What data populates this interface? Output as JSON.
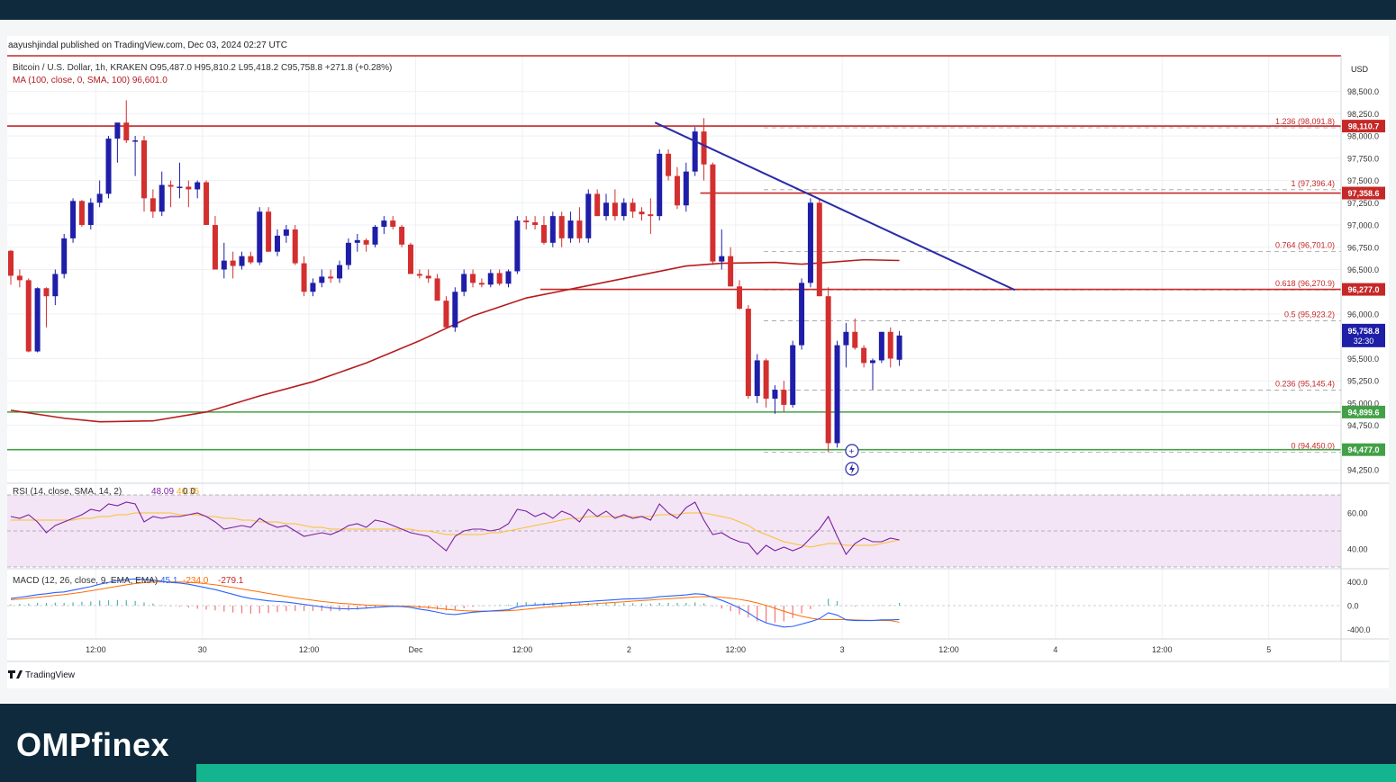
{
  "header": {
    "published": "aayushjindal published on TradingView.com, Dec 03, 2024 02:27 UTC"
  },
  "chart_data": {
    "type": "candlestick",
    "symbol_line": "Bitcoin / U.S. Dollar, 1h, KRAKEN  O95,487.0  H95,810.2  L95,418.2  C95,758.8  +271.8 (+0.28%)",
    "ma_line": "MA (100, close, 0, SMA, 100)  96,601.0",
    "currency": "USD",
    "price_axis": {
      "ylim": [
        94100,
        98900
      ],
      "ticks": [
        "98,500.0",
        "98,250.0",
        "98,000.0",
        "97,750.0",
        "97,500.0",
        "97,250.0",
        "97,000.0",
        "96,750.0",
        "96,500.0",
        "96,000.0",
        "95,500.0",
        "95,250.0",
        "95,000.0",
        "94,750.0",
        "94,250.0"
      ]
    },
    "time_axis": {
      "ticks": [
        {
          "label": "12:00",
          "bar": 12
        },
        {
          "label": "30",
          "bar": 24
        },
        {
          "label": "12:00",
          "bar": 36
        },
        {
          "label": "Dec",
          "bar": 48
        },
        {
          "label": "12:00",
          "bar": 60
        },
        {
          "label": "2",
          "bar": 72
        },
        {
          "label": "12:00",
          "bar": 84
        },
        {
          "label": "3",
          "bar": 96
        },
        {
          "label": "12:00",
          "bar": 108
        },
        {
          "label": "4",
          "bar": 120
        },
        {
          "label": "12:00",
          "bar": 132
        },
        {
          "label": "5",
          "bar": 144
        }
      ]
    },
    "candles": [
      [
        96710,
        96720,
        96330,
        96430
      ],
      [
        96430,
        96500,
        96300,
        96380
      ],
      [
        96380,
        96400,
        95570,
        95580
      ],
      [
        95580,
        96300,
        95570,
        96290
      ],
      [
        96290,
        96300,
        95850,
        96200
      ],
      [
        96200,
        96500,
        96100,
        96450
      ],
      [
        96450,
        96900,
        96400,
        96850
      ],
      [
        96850,
        97300,
        96800,
        97270
      ],
      [
        97270,
        97280,
        96980,
        97000
      ],
      [
        97000,
        97300,
        96950,
        97250
      ],
      [
        97250,
        97500,
        97200,
        97350
      ],
      [
        97350,
        98000,
        97300,
        97970
      ],
      [
        97970,
        98100,
        97700,
        98150
      ],
      [
        98150,
        98400,
        97920,
        97950
      ],
      [
        97950,
        98000,
        97550,
        97950
      ],
      [
        97950,
        98000,
        97150,
        97300
      ],
      [
        97300,
        97400,
        97080,
        97150
      ],
      [
        97150,
        97600,
        97100,
        97450
      ],
      [
        97450,
        97500,
        97200,
        97430
      ],
      [
        97430,
        97700,
        97300,
        97430
      ],
      [
        97430,
        97500,
        97200,
        97400
      ],
      [
        97400,
        97500,
        97300,
        97480
      ],
      [
        97480,
        97500,
        97000,
        97000
      ],
      [
        97000,
        97100,
        96500,
        96500
      ],
      [
        96500,
        96800,
        96400,
        96600
      ],
      [
        96600,
        96700,
        96400,
        96540
      ],
      [
        96540,
        96700,
        96500,
        96650
      ],
      [
        96650,
        96700,
        96560,
        96580
      ],
      [
        96580,
        97200,
        96550,
        97150
      ],
      [
        97150,
        97200,
        96700,
        96700
      ],
      [
        96700,
        96950,
        96650,
        96880
      ],
      [
        96880,
        97000,
        96800,
        96950
      ],
      [
        96950,
        97000,
        96550,
        96570
      ],
      [
        96570,
        96650,
        96200,
        96250
      ],
      [
        96250,
        96400,
        96200,
        96350
      ],
      [
        96350,
        96500,
        96300,
        96420
      ],
      [
        96420,
        96500,
        96350,
        96400
      ],
      [
        96400,
        96600,
        96350,
        96550
      ],
      [
        96550,
        96850,
        96500,
        96800
      ],
      [
        96800,
        96900,
        96700,
        96830
      ],
      [
        96830,
        96850,
        96700,
        96780
      ],
      [
        96780,
        97000,
        96750,
        96980
      ],
      [
        96980,
        97100,
        96900,
        97050
      ],
      [
        97050,
        97100,
        96950,
        96980
      ],
      [
        96980,
        97000,
        96750,
        96780
      ],
      [
        96780,
        96800,
        96450,
        96450
      ],
      [
        96450,
        96500,
        96400,
        96430
      ],
      [
        96430,
        96500,
        96350,
        96400
      ],
      [
        96400,
        96450,
        96150,
        96150
      ],
      [
        96150,
        96200,
        95850,
        95850
      ],
      [
        95850,
        96300,
        95800,
        96250
      ],
      [
        96250,
        96500,
        96200,
        96450
      ],
      [
        96450,
        96500,
        96300,
        96350
      ],
      [
        96350,
        96400,
        96300,
        96330
      ],
      [
        96330,
        96500,
        96300,
        96460
      ],
      [
        96460,
        96500,
        96320,
        96340
      ],
      [
        96340,
        96500,
        96300,
        96480
      ],
      [
        96480,
        97100,
        96450,
        97050
      ],
      [
        97050,
        97100,
        96950,
        97030
      ],
      [
        97030,
        97100,
        96950,
        97000
      ],
      [
        97000,
        97100,
        96780,
        96800
      ],
      [
        96800,
        97150,
        96750,
        97100
      ],
      [
        97100,
        97150,
        96750,
        96850
      ],
      [
        96850,
        97150,
        96800,
        97050
      ],
      [
        97050,
        97200,
        96800,
        96850
      ],
      [
        96850,
        97400,
        96800,
        97350
      ],
      [
        97350,
        97400,
        97100,
        97100
      ],
      [
        97100,
        97350,
        97050,
        97250
      ],
      [
        97250,
        97400,
        97050,
        97100
      ],
      [
        97100,
        97300,
        97050,
        97250
      ],
      [
        97250,
        97300,
        97080,
        97150
      ],
      [
        97150,
        97200,
        97050,
        97120
      ],
      [
        97120,
        97300,
        96900,
        97100
      ],
      [
        97100,
        97850,
        97050,
        97800
      ],
      [
        97800,
        97850,
        97500,
        97550
      ],
      [
        97550,
        97650,
        97180,
        97220
      ],
      [
        97220,
        97700,
        97150,
        97600
      ],
      [
        97600,
        98100,
        97550,
        98050
      ],
      [
        98050,
        98200,
        97500,
        97680
      ],
      [
        97680,
        97700,
        96550,
        96590
      ],
      [
        96590,
        96950,
        96500,
        96650
      ],
      [
        96650,
        96750,
        96310,
        96310
      ],
      [
        96310,
        96380,
        96050,
        96060
      ],
      [
        96060,
        96100,
        95050,
        95080
      ],
      [
        95080,
        95550,
        95000,
        95480
      ],
      [
        95480,
        95500,
        94950,
        95050
      ],
      [
        95050,
        95200,
        94880,
        95150
      ],
      [
        95150,
        95250,
        94900,
        94980
      ],
      [
        94980,
        95700,
        94950,
        95650
      ],
      [
        95650,
        96400,
        95600,
        96350
      ],
      [
        96350,
        97300,
        96300,
        97250
      ],
      [
        97250,
        97300,
        96200,
        96200
      ],
      [
        96200,
        96300,
        94450,
        94550
      ],
      [
        94550,
        95700,
        94500,
        95650
      ],
      [
        95650,
        95900,
        95400,
        95800
      ],
      [
        95800,
        95950,
        95600,
        95620
      ],
      [
        95620,
        95650,
        95400,
        95450
      ],
      [
        95450,
        95500,
        95150,
        95480
      ],
      [
        95480,
        95800,
        95450,
        95800
      ],
      [
        95800,
        95850,
        95400,
        95500
      ],
      [
        95487,
        95810,
        95418,
        95759
      ]
    ],
    "ma100": [
      {
        "bar": 0,
        "value": 94920
      },
      {
        "bar": 6,
        "value": 94830
      },
      {
        "bar": 10,
        "value": 94790
      },
      {
        "bar": 16,
        "value": 94800
      },
      {
        "bar": 22,
        "value": 94900
      },
      {
        "bar": 28,
        "value": 95080
      },
      {
        "bar": 34,
        "value": 95240
      },
      {
        "bar": 40,
        "value": 95450
      },
      {
        "bar": 46,
        "value": 95700
      },
      {
        "bar": 52,
        "value": 95980
      },
      {
        "bar": 58,
        "value": 96180
      },
      {
        "bar": 64,
        "value": 96300
      },
      {
        "bar": 70,
        "value": 96420
      },
      {
        "bar": 76,
        "value": 96540
      },
      {
        "bar": 80,
        "value": 96570
      },
      {
        "bar": 86,
        "value": 96580
      },
      {
        "bar": 89,
        "value": 96560
      },
      {
        "bar": 92,
        "value": 96580
      },
      {
        "bar": 96,
        "value": 96610
      },
      {
        "bar": 100,
        "value": 96601
      }
    ],
    "horizontal_lines": [
      {
        "price": 98900,
        "color": "#c62828",
        "from_bar": 0
      },
      {
        "price": 98110.7,
        "color": "#c62828",
        "from_bar": 0,
        "label": "98,110.7"
      },
      {
        "price": 97358.6,
        "color": "#c62828",
        "from_bar": 78,
        "label": "97,358.6"
      },
      {
        "price": 96277.0,
        "color": "#c62828",
        "from_bar": 60,
        "label": "96,277.0"
      },
      {
        "price": 94899.6,
        "color": "#43a047",
        "from_bar": 0,
        "label": "94,899.6"
      },
      {
        "price": 94477.0,
        "color": "#43a047",
        "from_bar": 0,
        "label": "94,477.0"
      }
    ],
    "trendline": {
      "from": {
        "bar": 72.5,
        "price": 98150
      },
      "to": {
        "bar": 113,
        "price": 96270
      },
      "color": "#2a2aa8"
    },
    "fibonacci": [
      {
        "label": "1.236 (98,091.8)",
        "price": 98091.8
      },
      {
        "label": "1 (97,396.4)",
        "price": 97396.4
      },
      {
        "label": "0.764 (96,701.0)",
        "price": 96701.0
      },
      {
        "label": "0.618 (96,270.9)",
        "price": 96270.9
      },
      {
        "label": "0.5 (95,923.2)",
        "price": 95923.2
      },
      {
        "label": "0.236 (95,145.4)",
        "price": 95145.4
      },
      {
        "label": "0 (94,450.0)",
        "price": 94450.0
      }
    ],
    "last_price": {
      "label": "95,758.8",
      "countdown": "32:30",
      "price": 95758.8
    },
    "rsi": {
      "header": "RSI (14, close, SMA, 14, 2)",
      "value": "48.09",
      "value2": "46.35",
      "extra": "0  0",
      "ticks": [
        "60.00",
        "40.00"
      ],
      "ylim": [
        30,
        75
      ],
      "band": [
        30,
        70
      ],
      "values": [
        58,
        57,
        59,
        55,
        49,
        53,
        55,
        57,
        59,
        62,
        61,
        65,
        64,
        66,
        65,
        55,
        58,
        57,
        58,
        58,
        59,
        60,
        58,
        55,
        51,
        52,
        53,
        52,
        57,
        54,
        52,
        53,
        50,
        47,
        48,
        49,
        48,
        50,
        53,
        54,
        52,
        56,
        55,
        53,
        51,
        49,
        48,
        47,
        43,
        39,
        47,
        50,
        51,
        51,
        50,
        51,
        54,
        62,
        61,
        58,
        60,
        57,
        61,
        59,
        55,
        62,
        58,
        61,
        57,
        59,
        57,
        58,
        56,
        65,
        60,
        57,
        63,
        66,
        56,
        48,
        49,
        46,
        44,
        43,
        37,
        42,
        39,
        41,
        39,
        41,
        46,
        51,
        58,
        47,
        37,
        43,
        46,
        44,
        44,
        46,
        45
      ],
      "sma": [
        56,
        56,
        56,
        56,
        56,
        56,
        56,
        56,
        57,
        57,
        58,
        58,
        59,
        59,
        60,
        60,
        60,
        60,
        60,
        59,
        59,
        59,
        58,
        58,
        57,
        57,
        56,
        56,
        55,
        55,
        55,
        54,
        54,
        53,
        52,
        52,
        51,
        51,
        51,
        51,
        51,
        51,
        51,
        51,
        51,
        51,
        50,
        50,
        49,
        48,
        48,
        48,
        48,
        48,
        49,
        49,
        50,
        51,
        52,
        53,
        54,
        55,
        56,
        57,
        57,
        58,
        58,
        58,
        58,
        58,
        58,
        58,
        58,
        59,
        59,
        59,
        60,
        60,
        60,
        59,
        58,
        57,
        55,
        53,
        50,
        48,
        46,
        44,
        43,
        42,
        41,
        42,
        43,
        43,
        42,
        42,
        42,
        42,
        43,
        44,
        45
      ]
    },
    "macd": {
      "header": "MACD (12, 26, close, 9, EMA, EMA)",
      "value": "45.1",
      "value2": "-234.0",
      "value3": "-279.1",
      "ticks": [
        "400.0",
        "0.0",
        "-400.0"
      ],
      "ylim": [
        -560,
        560
      ],
      "macd": [
        120,
        140,
        160,
        185,
        200,
        220,
        230,
        260,
        290,
        320,
        360,
        390,
        420,
        440,
        450,
        440,
        430,
        410,
        390,
        380,
        360,
        330,
        300,
        270,
        230,
        190,
        150,
        120,
        100,
        80,
        70,
        60,
        40,
        20,
        0,
        -20,
        -40,
        -50,
        -55,
        -50,
        -40,
        -30,
        -20,
        -10,
        -15,
        -30,
        -60,
        -80,
        -110,
        -140,
        -150,
        -130,
        -110,
        -100,
        -90,
        -80,
        -70,
        -20,
        0,
        10,
        20,
        30,
        40,
        50,
        60,
        70,
        80,
        90,
        100,
        110,
        115,
        120,
        130,
        150,
        160,
        170,
        180,
        200,
        190,
        140,
        90,
        30,
        -40,
        -120,
        -220,
        -290,
        -330,
        -360,
        -350,
        -310,
        -270,
        -220,
        -120,
        -160,
        -240,
        -250,
        -250,
        -250,
        -240,
        -240,
        -234
      ],
      "signal": [
        100,
        110,
        125,
        140,
        155,
        170,
        185,
        205,
        225,
        250,
        275,
        300,
        325,
        350,
        370,
        385,
        395,
        400,
        400,
        398,
        392,
        382,
        368,
        350,
        330,
        305,
        280,
        255,
        230,
        205,
        180,
        155,
        130,
        110,
        90,
        70,
        55,
        40,
        30,
        20,
        10,
        5,
        0,
        -5,
        -8,
        -12,
        -20,
        -30,
        -45,
        -60,
        -75,
        -85,
        -90,
        -92,
        -92,
        -90,
        -86,
        -75,
        -60,
        -45,
        -30,
        -18,
        -8,
        5,
        15,
        25,
        35,
        45,
        55,
        65,
        75,
        85,
        95,
        105,
        115,
        125,
        135,
        145,
        152,
        150,
        140,
        125,
        105,
        80,
        45,
        5,
        -45,
        -95,
        -140,
        -180,
        -210,
        -230,
        -235,
        -235,
        -235,
        -240,
        -245,
        -248,
        -250,
        -252,
        -279
      ],
      "histogram": [
        20,
        30,
        35,
        45,
        45,
        50,
        45,
        55,
        65,
        70,
        85,
        90,
        95,
        90,
        80,
        55,
        35,
        10,
        -10,
        -18,
        -32,
        -52,
        -68,
        -80,
        -100,
        -115,
        -130,
        -135,
        -130,
        -125,
        -110,
        -95,
        -90,
        -90,
        -90,
        -90,
        -95,
        -90,
        -85,
        -70,
        -50,
        -35,
        -20,
        -5,
        -7,
        -18,
        -40,
        -50,
        -65,
        -80,
        -75,
        -45,
        -20,
        -8,
        2,
        10,
        16,
        55,
        60,
        55,
        50,
        48,
        48,
        45,
        45,
        45,
        45,
        45,
        45,
        45,
        40,
        35,
        35,
        45,
        45,
        45,
        45,
        55,
        38,
        -10,
        -50,
        -95,
        -145,
        -200,
        -265,
        -295,
        -285,
        -265,
        -210,
        -130,
        -60,
        10,
        115,
        75,
        -5,
        -15,
        -5,
        -2,
        10,
        12,
        45
      ]
    }
  },
  "footer": {
    "tradingview_label": "TradingView",
    "brand": "OMPfinex"
  },
  "colors": {
    "up": "#1e1ea8",
    "down": "#d32f2f",
    "ma": "#b71c1c",
    "rsi": "#7b1fa2",
    "rsi_sma": "#fbc02d",
    "macd": "#2962ff",
    "macd_signal": "#ff6d00",
    "band": "#f3e5f5",
    "brand_dark": "#0f2a3c",
    "brand_green": "#13b48e"
  }
}
